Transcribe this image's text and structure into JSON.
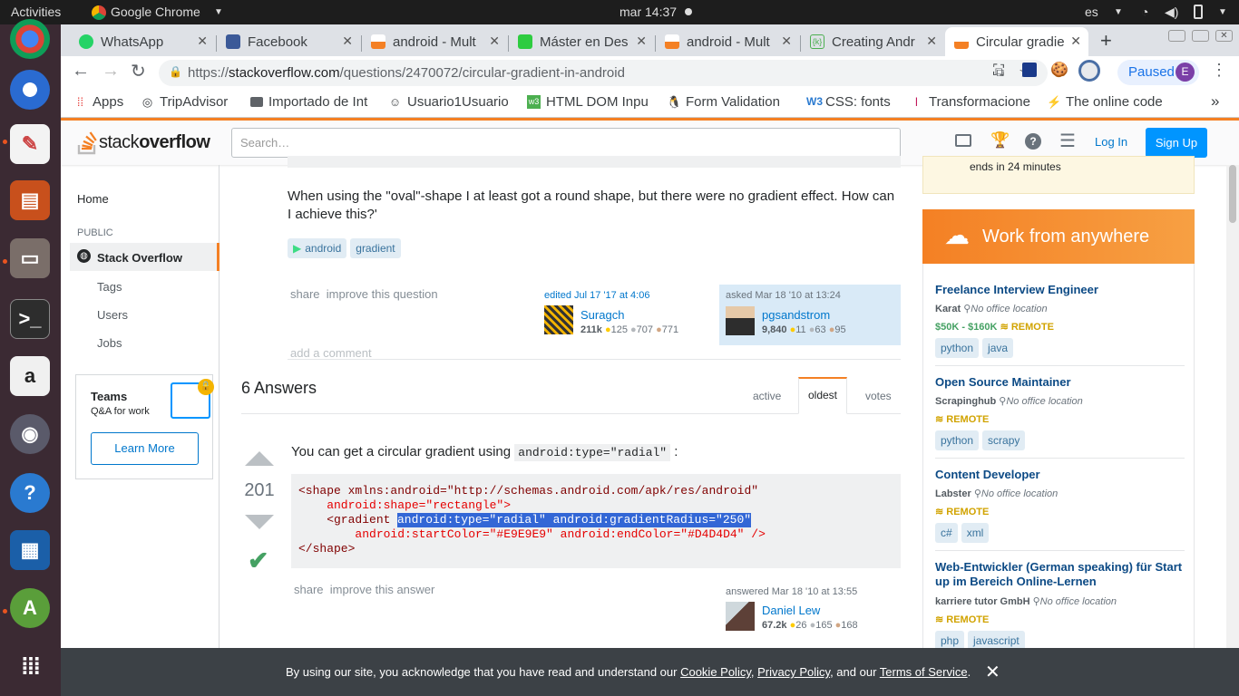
{
  "topbar": {
    "activities": "Activities",
    "app": "Google Chrome",
    "clock": "mar 14:37",
    "lang": "es"
  },
  "dock": [
    "chrome",
    "thunderbird",
    "notes",
    "impress",
    "files",
    "terminal",
    "amazon",
    "speaker",
    "help",
    "writer",
    "android-studio",
    "apps-grid"
  ],
  "tabs": [
    {
      "label": "WhatsApp",
      "color": "#25d366"
    },
    {
      "label": "Facebook",
      "color": "#3b5998"
    },
    {
      "label": "android - Mult",
      "color": "#f48024"
    },
    {
      "label": "Máster en Des",
      "color": "#2ecc40"
    },
    {
      "label": "android - Mult",
      "color": "#f48024"
    },
    {
      "label": "Creating Andr",
      "color": "#4caf50"
    },
    {
      "label": "Circular gradie",
      "color": "#f48024"
    }
  ],
  "toolbar": {
    "url_scheme": "https://",
    "url_host": "stackoverflow.com",
    "url_path": "/questions/2470072/circular-gradient-in-android",
    "paused": "Paused",
    "profile": "E"
  },
  "bookmarks": [
    "Apps",
    "TripAdvisor",
    "Importado de Int",
    "Usuario1Usuario",
    "HTML DOM Inpu",
    "Form Validation",
    "CSS: fonts",
    "Transformacione",
    "The online code"
  ],
  "so": {
    "logo_a": "stack",
    "logo_b": "overflow",
    "search_placeholder": "Search…",
    "login": "Log In",
    "signup": "Sign Up"
  },
  "nav": {
    "home": "Home",
    "public": "PUBLIC",
    "stackoverflow": "Stack Overflow",
    "tags": "Tags",
    "users": "Users",
    "jobs": "Jobs",
    "teams_title": "Teams",
    "teams_sub": "Q&A for work",
    "learn_more": "Learn More"
  },
  "question": {
    "text": "When using the \"oval\"-shape I at least got a round shape, but there were no gradient effect. How can I achieve this?'",
    "tags": [
      "android",
      "gradient"
    ],
    "share": "share",
    "improve": "improve this question",
    "edited": "edited Jul 17 '17 at 4:06",
    "editor": "Suragch",
    "editor_rep": "211k",
    "editor_gold": "125",
    "editor_silver": "707",
    "editor_bronze": "771",
    "asked": "asked Mar 18 '10 at 13:24",
    "asker": "pgsandstrom",
    "asker_rep": "9,840",
    "asker_gold": "11",
    "asker_silver": "63",
    "asker_bronze": "95",
    "add_comment": "add a comment"
  },
  "answers": {
    "count": "6 Answers",
    "tabs": [
      "active",
      "oldest",
      "votes"
    ],
    "votes": "201",
    "intro": "You can get a circular gradient using",
    "inline_code": "android:type=\"radial\"",
    "intro_end": ":",
    "code": [
      "<shape xmlns:android=\"http://schemas.android.com/apk/res/android\"",
      "    android:shape=\"rectangle\">",
      "    <gradient ",
      "android:type=\"radial\" android:gradientRadius=\"250\"",
      "        android:startColor=\"#E9E9E9\" android:endColor=\"#D4D4D4\" />",
      "</shape>"
    ],
    "share": "share",
    "improve": "improve this answer",
    "answered": "answered Mar 18 '10 at 13:55",
    "author": "Daniel Lew",
    "author_rep": "67.2k",
    "author_gold": "26",
    "author_silver": "165",
    "author_bronze": "168"
  },
  "sidebar": {
    "ends": "ends in 24 minutes",
    "banner": "Work from anywhere",
    "jobs": [
      {
        "title": "Freelance Interview Engineer",
        "company": "Karat",
        "location": "No office location",
        "salary": "$50K - $160K",
        "remote": "REMOTE",
        "tags": [
          "python",
          "java"
        ]
      },
      {
        "title": "Open Source Maintainer",
        "company": "Scrapinghub",
        "location": "No office location",
        "remote": "REMOTE",
        "tags": [
          "python",
          "scrapy"
        ]
      },
      {
        "title": "Content Developer",
        "company": "Labster",
        "location": "No office location",
        "remote": "REMOTE",
        "tags": [
          "c#",
          "xml"
        ]
      },
      {
        "title": "Web-Entwickler (German speaking) für Start up im Bereich Online-Lernen",
        "company": "karriere tutor GmbH",
        "location": "No office location",
        "remote": "REMOTE",
        "tags": [
          "php",
          "javascript"
        ]
      }
    ]
  },
  "cookie": {
    "pre": "By using our site, you acknowledge that you have read and understand our",
    "cookie_policy": "Cookie Policy",
    "comma": ",",
    "privacy": "Privacy Policy",
    "and": ", and our",
    "terms": "Terms of Service",
    "dot": "."
  }
}
